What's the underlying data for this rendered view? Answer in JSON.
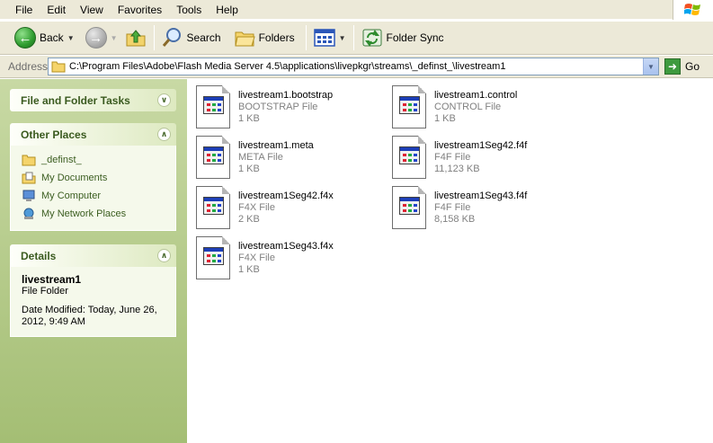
{
  "menu": [
    "File",
    "Edit",
    "View",
    "Favorites",
    "Tools",
    "Help"
  ],
  "toolbar": {
    "back": "Back",
    "search": "Search",
    "folders": "Folders",
    "folder_sync": "Folder Sync"
  },
  "address": {
    "label": "Address",
    "path": "C:\\Program Files\\Adobe\\Flash Media Server 4.5\\applications\\livepkgr\\streams\\_definst_\\livestream1",
    "go": "Go"
  },
  "panels": {
    "tasks": {
      "title": "File and Folder Tasks"
    },
    "other_places": {
      "title": "Other Places",
      "items": [
        {
          "label": "_definst_",
          "icon": "folder-icon"
        },
        {
          "label": "My Documents",
          "icon": "my-documents-icon"
        },
        {
          "label": "My Computer",
          "icon": "my-computer-icon"
        },
        {
          "label": "My Network Places",
          "icon": "network-places-icon"
        }
      ]
    },
    "details": {
      "title": "Details",
      "name": "livestream1",
      "kind": "File Folder",
      "modified_line1": "Date Modified: Today, June 26,",
      "modified_line2": "2012, 9:49 AM"
    }
  },
  "files": [
    {
      "name": "livestream1.bootstrap",
      "type": "BOOTSTRAP File",
      "size": "1 KB"
    },
    {
      "name": "livestream1.control",
      "type": "CONTROL File",
      "size": "1 KB"
    },
    {
      "name": "livestream1.meta",
      "type": "META File",
      "size": "1 KB"
    },
    {
      "name": "livestream1Seg42.f4f",
      "type": "F4F File",
      "size": "11,123 KB"
    },
    {
      "name": "livestream1Seg42.f4x",
      "type": "F4X File",
      "size": "2 KB"
    },
    {
      "name": "livestream1Seg43.f4f",
      "type": "F4F File",
      "size": "8,158 KB"
    },
    {
      "name": "livestream1Seg43.f4x",
      "type": "F4X File",
      "size": "1 KB"
    }
  ]
}
